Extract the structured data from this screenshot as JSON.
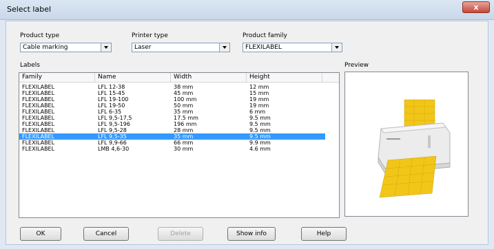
{
  "window": {
    "title": "Select label",
    "close_glyph": "x"
  },
  "filters": {
    "product_type": {
      "label": "Product type",
      "value": "Cable marking"
    },
    "printer_type": {
      "label": "Printer type",
      "value": "Laser"
    },
    "product_family": {
      "label": "Product family",
      "value": "FLEXILABEL"
    }
  },
  "labels": {
    "title": "Labels",
    "columns": [
      "Family",
      "Name",
      "Width",
      "Height"
    ],
    "rows": [
      [
        "FLEXILABEL",
        "LFL 12-38",
        "38 mm",
        "12 mm"
      ],
      [
        "FLEXILABEL",
        "LFL 15-45",
        "45 mm",
        "15 mm"
      ],
      [
        "FLEXILABEL",
        "LFL 19-100",
        "100 mm",
        "19 mm"
      ],
      [
        "FLEXILABEL",
        "LFL 19-50",
        "50 mm",
        "19 mm"
      ],
      [
        "FLEXILABEL",
        "LFL 6-35",
        "35 mm",
        "6 mm"
      ],
      [
        "FLEXILABEL",
        "LFL 9,5-17,5",
        "17.5 mm",
        "9.5 mm"
      ],
      [
        "FLEXILABEL",
        "LFL 9,5-196",
        "196 mm",
        "9.5 mm"
      ],
      [
        "FLEXILABEL",
        "LFL 9,5-28",
        "28 mm",
        "9.5 mm"
      ],
      [
        "FLEXILABEL",
        "LFL 9,5-35",
        "35 mm",
        "9.5 mm"
      ],
      [
        "FLEXILABEL",
        "LFL 9,9-66",
        "66 mm",
        "9.9 mm"
      ],
      [
        "FLEXILABEL",
        "LMB 4,6-30",
        "30 mm",
        "4.6 mm"
      ]
    ],
    "selected_index": 8
  },
  "preview": {
    "title": "Preview",
    "icon": "printer-with-labels-icon"
  },
  "buttons": {
    "ok": "OK",
    "cancel": "Cancel",
    "delete": "Delete",
    "show_info": "Show info",
    "help": "Help"
  },
  "colors": {
    "selection": "#3399ff",
    "label_sheet": "#f2c619"
  }
}
